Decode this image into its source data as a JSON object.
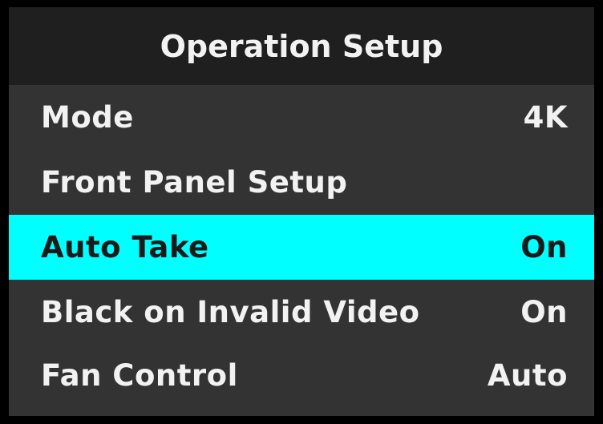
{
  "title": "Operation Setup",
  "menu": [
    {
      "label": "Mode",
      "value": "4K",
      "selected": false
    },
    {
      "label": "Front Panel Setup",
      "value": "",
      "selected": false
    },
    {
      "label": "Auto Take",
      "value": "On",
      "selected": true
    },
    {
      "label": "Black on Invalid Video",
      "value": "On",
      "selected": false
    },
    {
      "label": "Fan Control",
      "value": "Auto",
      "selected": false
    }
  ],
  "colors": {
    "background": "#333333",
    "title_bar": "#1f1f1f",
    "highlight": "#00ffff",
    "text": "#f2f2f2",
    "selected_text": "#1a1a1a"
  }
}
